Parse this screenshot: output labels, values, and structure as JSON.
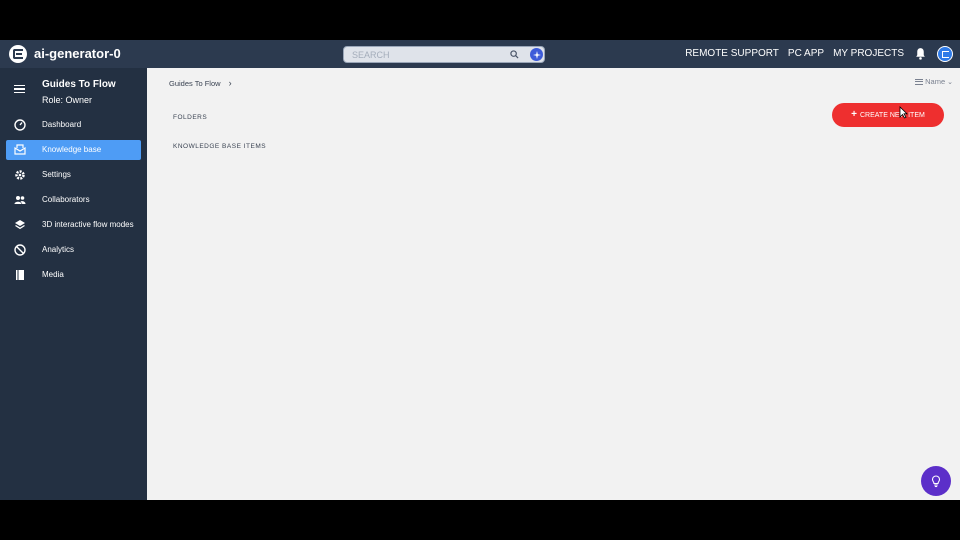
{
  "header": {
    "app_title": "ai-generator-0",
    "search_placeholder": "SEARCH",
    "links": [
      "REMOTE SUPPORT",
      "PC APP",
      "MY PROJECTS"
    ]
  },
  "sidebar": {
    "title": "Guides To Flow",
    "role": "Role: Owner",
    "items": [
      {
        "label": "Dashboard",
        "icon": "dashboard-icon",
        "active": false
      },
      {
        "label": "Knowledge base",
        "icon": "knowledge-base-icon",
        "active": true
      },
      {
        "label": "Settings",
        "icon": "gear-icon",
        "active": false
      },
      {
        "label": "Collaborators",
        "icon": "people-icon",
        "active": false
      },
      {
        "label": "3D interactive flow modes",
        "icon": "layers-icon",
        "active": false
      },
      {
        "label": "Analytics",
        "icon": "analytics-icon",
        "active": false
      },
      {
        "label": "Media",
        "icon": "media-icon",
        "active": false
      }
    ]
  },
  "main": {
    "breadcrumb": [
      "Guides To Flow"
    ],
    "sort_label": "Name",
    "folders_label": "FOLDERS",
    "kb_items_label": "KNOWLEDGE BASE ITEMS",
    "create_button_label": "CREATE NEW ITEM"
  },
  "colors": {
    "topbar": "#2c3a4f",
    "sidebar": "#233042",
    "active_item": "#4e9cf5",
    "create_button": "#ee2f2f",
    "help_button": "#5c2fc9",
    "content_bg": "#f2f2f2"
  }
}
